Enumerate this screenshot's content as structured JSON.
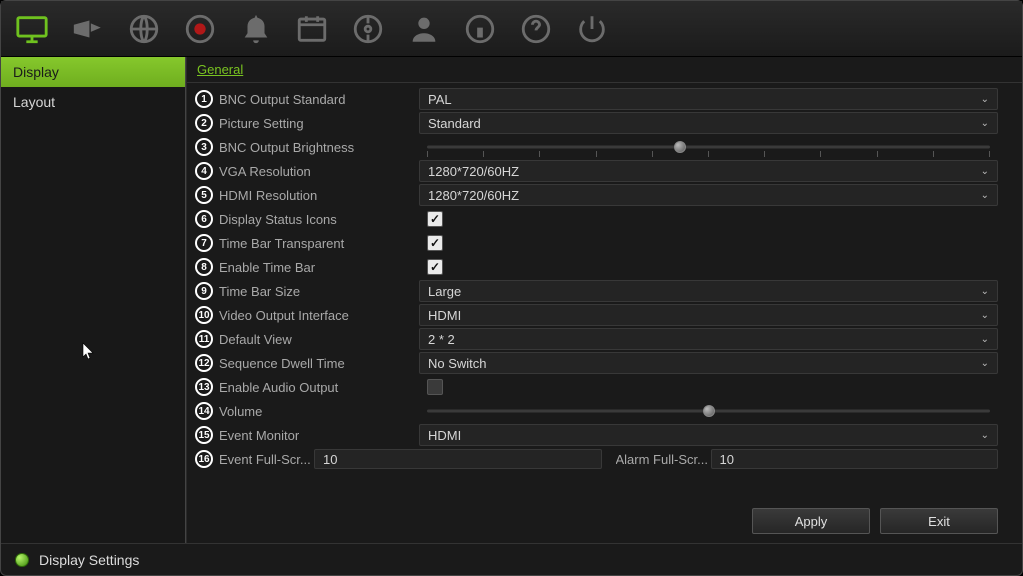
{
  "sidebar": {
    "items": [
      {
        "label": "Display",
        "active": true
      },
      {
        "label": "Layout",
        "active": false
      }
    ]
  },
  "tabs": [
    {
      "label": "General",
      "active": true
    }
  ],
  "rows": [
    {
      "n": "1",
      "label": "BNC Output Standard",
      "type": "select",
      "value": "PAL"
    },
    {
      "n": "2",
      "label": "Picture Setting",
      "type": "select",
      "value": "Standard"
    },
    {
      "n": "3",
      "label": "BNC Output Brightness",
      "type": "slider",
      "value": 45,
      "ticks": 11
    },
    {
      "n": "4",
      "label": "VGA Resolution",
      "type": "select",
      "value": "1280*720/60HZ"
    },
    {
      "n": "5",
      "label": "HDMI Resolution",
      "type": "select",
      "value": "1280*720/60HZ"
    },
    {
      "n": "6",
      "label": "Display Status Icons",
      "type": "checkbox",
      "checked": true
    },
    {
      "n": "7",
      "label": "Time Bar Transparent",
      "type": "checkbox",
      "checked": true
    },
    {
      "n": "8",
      "label": "Enable Time Bar",
      "type": "checkbox",
      "checked": true
    },
    {
      "n": "9",
      "label": "Time Bar Size",
      "type": "select",
      "value": "Large"
    },
    {
      "n": "10",
      "label": "Video Output Interface",
      "type": "select",
      "value": "HDMI"
    },
    {
      "n": "11",
      "label": "Default View",
      "type": "select",
      "value": "2 * 2"
    },
    {
      "n": "12",
      "label": "Sequence Dwell Time",
      "type": "select",
      "value": "No Switch"
    },
    {
      "n": "13",
      "label": "Enable Audio Output",
      "type": "checkbox",
      "checked": false
    },
    {
      "n": "14",
      "label": "Volume",
      "type": "slider",
      "value": 50,
      "ticks": 0
    },
    {
      "n": "15",
      "label": "Event Monitor",
      "type": "select",
      "value": "HDMI"
    },
    {
      "n": "16",
      "label_a": "Event Full-Scr...",
      "value_a": "10",
      "label_b": "Alarm Full-Scr...",
      "value_b": "10",
      "type": "split"
    }
  ],
  "buttons": {
    "apply": "Apply",
    "exit": "Exit"
  },
  "footer": {
    "title": "Display Settings"
  },
  "toolbar_icons": [
    "monitor-icon",
    "camera-icon",
    "globe-icon",
    "record-icon",
    "alarm-icon",
    "schedule-icon",
    "disk-icon",
    "user-icon",
    "info-icon",
    "help-icon",
    "power-icon"
  ]
}
